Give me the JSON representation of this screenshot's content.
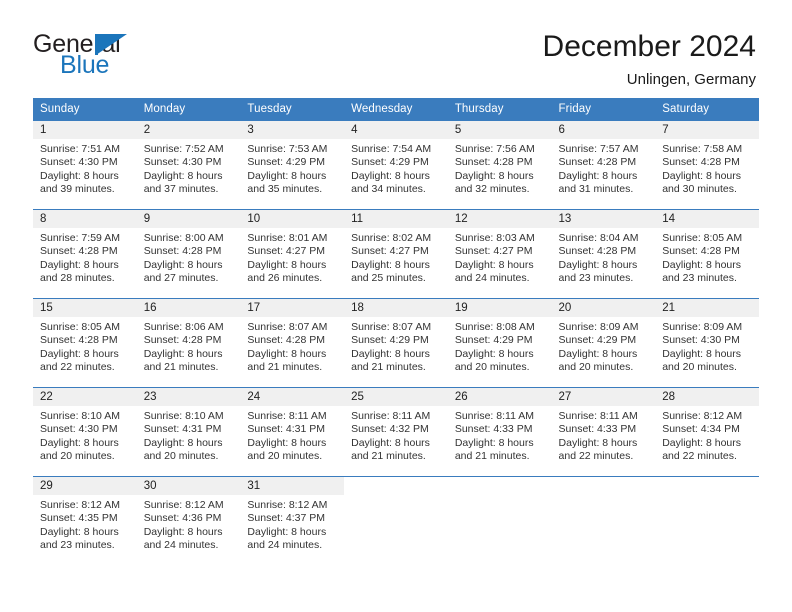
{
  "logo": {
    "word_one": "General",
    "word_two": "Blue",
    "flag_icon": "triangle-flag-icon",
    "brand_color": "#1b75bb"
  },
  "header": {
    "title": "December 2024",
    "subtitle": "Unlingen, Germany"
  },
  "theme": {
    "header_blue": "#3a7cbe",
    "daynum_band": "#f0f0f0",
    "text": "#333333"
  },
  "calendar": {
    "weekday_headers": [
      "Sunday",
      "Monday",
      "Tuesday",
      "Wednesday",
      "Thursday",
      "Friday",
      "Saturday"
    ],
    "weeks": [
      [
        {
          "day": "1",
          "sunrise": "Sunrise: 7:51 AM",
          "sunset": "Sunset: 4:30 PM",
          "daylight_line1": "Daylight: 8 hours",
          "daylight_line2": "and 39 minutes."
        },
        {
          "day": "2",
          "sunrise": "Sunrise: 7:52 AM",
          "sunset": "Sunset: 4:30 PM",
          "daylight_line1": "Daylight: 8 hours",
          "daylight_line2": "and 37 minutes."
        },
        {
          "day": "3",
          "sunrise": "Sunrise: 7:53 AM",
          "sunset": "Sunset: 4:29 PM",
          "daylight_line1": "Daylight: 8 hours",
          "daylight_line2": "and 35 minutes."
        },
        {
          "day": "4",
          "sunrise": "Sunrise: 7:54 AM",
          "sunset": "Sunset: 4:29 PM",
          "daylight_line1": "Daylight: 8 hours",
          "daylight_line2": "and 34 minutes."
        },
        {
          "day": "5",
          "sunrise": "Sunrise: 7:56 AM",
          "sunset": "Sunset: 4:28 PM",
          "daylight_line1": "Daylight: 8 hours",
          "daylight_line2": "and 32 minutes."
        },
        {
          "day": "6",
          "sunrise": "Sunrise: 7:57 AM",
          "sunset": "Sunset: 4:28 PM",
          "daylight_line1": "Daylight: 8 hours",
          "daylight_line2": "and 31 minutes."
        },
        {
          "day": "7",
          "sunrise": "Sunrise: 7:58 AM",
          "sunset": "Sunset: 4:28 PM",
          "daylight_line1": "Daylight: 8 hours",
          "daylight_line2": "and 30 minutes."
        }
      ],
      [
        {
          "day": "8",
          "sunrise": "Sunrise: 7:59 AM",
          "sunset": "Sunset: 4:28 PM",
          "daylight_line1": "Daylight: 8 hours",
          "daylight_line2": "and 28 minutes."
        },
        {
          "day": "9",
          "sunrise": "Sunrise: 8:00 AM",
          "sunset": "Sunset: 4:28 PM",
          "daylight_line1": "Daylight: 8 hours",
          "daylight_line2": "and 27 minutes."
        },
        {
          "day": "10",
          "sunrise": "Sunrise: 8:01 AM",
          "sunset": "Sunset: 4:27 PM",
          "daylight_line1": "Daylight: 8 hours",
          "daylight_line2": "and 26 minutes."
        },
        {
          "day": "11",
          "sunrise": "Sunrise: 8:02 AM",
          "sunset": "Sunset: 4:27 PM",
          "daylight_line1": "Daylight: 8 hours",
          "daylight_line2": "and 25 minutes."
        },
        {
          "day": "12",
          "sunrise": "Sunrise: 8:03 AM",
          "sunset": "Sunset: 4:27 PM",
          "daylight_line1": "Daylight: 8 hours",
          "daylight_line2": "and 24 minutes."
        },
        {
          "day": "13",
          "sunrise": "Sunrise: 8:04 AM",
          "sunset": "Sunset: 4:28 PM",
          "daylight_line1": "Daylight: 8 hours",
          "daylight_line2": "and 23 minutes."
        },
        {
          "day": "14",
          "sunrise": "Sunrise: 8:05 AM",
          "sunset": "Sunset: 4:28 PM",
          "daylight_line1": "Daylight: 8 hours",
          "daylight_line2": "and 23 minutes."
        }
      ],
      [
        {
          "day": "15",
          "sunrise": "Sunrise: 8:05 AM",
          "sunset": "Sunset: 4:28 PM",
          "daylight_line1": "Daylight: 8 hours",
          "daylight_line2": "and 22 minutes."
        },
        {
          "day": "16",
          "sunrise": "Sunrise: 8:06 AM",
          "sunset": "Sunset: 4:28 PM",
          "daylight_line1": "Daylight: 8 hours",
          "daylight_line2": "and 21 minutes."
        },
        {
          "day": "17",
          "sunrise": "Sunrise: 8:07 AM",
          "sunset": "Sunset: 4:28 PM",
          "daylight_line1": "Daylight: 8 hours",
          "daylight_line2": "and 21 minutes."
        },
        {
          "day": "18",
          "sunrise": "Sunrise: 8:07 AM",
          "sunset": "Sunset: 4:29 PM",
          "daylight_line1": "Daylight: 8 hours",
          "daylight_line2": "and 21 minutes."
        },
        {
          "day": "19",
          "sunrise": "Sunrise: 8:08 AM",
          "sunset": "Sunset: 4:29 PM",
          "daylight_line1": "Daylight: 8 hours",
          "daylight_line2": "and 20 minutes."
        },
        {
          "day": "20",
          "sunrise": "Sunrise: 8:09 AM",
          "sunset": "Sunset: 4:29 PM",
          "daylight_line1": "Daylight: 8 hours",
          "daylight_line2": "and 20 minutes."
        },
        {
          "day": "21",
          "sunrise": "Sunrise: 8:09 AM",
          "sunset": "Sunset: 4:30 PM",
          "daylight_line1": "Daylight: 8 hours",
          "daylight_line2": "and 20 minutes."
        }
      ],
      [
        {
          "day": "22",
          "sunrise": "Sunrise: 8:10 AM",
          "sunset": "Sunset: 4:30 PM",
          "daylight_line1": "Daylight: 8 hours",
          "daylight_line2": "and 20 minutes."
        },
        {
          "day": "23",
          "sunrise": "Sunrise: 8:10 AM",
          "sunset": "Sunset: 4:31 PM",
          "daylight_line1": "Daylight: 8 hours",
          "daylight_line2": "and 20 minutes."
        },
        {
          "day": "24",
          "sunrise": "Sunrise: 8:11 AM",
          "sunset": "Sunset: 4:31 PM",
          "daylight_line1": "Daylight: 8 hours",
          "daylight_line2": "and 20 minutes."
        },
        {
          "day": "25",
          "sunrise": "Sunrise: 8:11 AM",
          "sunset": "Sunset: 4:32 PM",
          "daylight_line1": "Daylight: 8 hours",
          "daylight_line2": "and 21 minutes."
        },
        {
          "day": "26",
          "sunrise": "Sunrise: 8:11 AM",
          "sunset": "Sunset: 4:33 PM",
          "daylight_line1": "Daylight: 8 hours",
          "daylight_line2": "and 21 minutes."
        },
        {
          "day": "27",
          "sunrise": "Sunrise: 8:11 AM",
          "sunset": "Sunset: 4:33 PM",
          "daylight_line1": "Daylight: 8 hours",
          "daylight_line2": "and 22 minutes."
        },
        {
          "day": "28",
          "sunrise": "Sunrise: 8:12 AM",
          "sunset": "Sunset: 4:34 PM",
          "daylight_line1": "Daylight: 8 hours",
          "daylight_line2": "and 22 minutes."
        }
      ],
      [
        {
          "day": "29",
          "sunrise": "Sunrise: 8:12 AM",
          "sunset": "Sunset: 4:35 PM",
          "daylight_line1": "Daylight: 8 hours",
          "daylight_line2": "and 23 minutes."
        },
        {
          "day": "30",
          "sunrise": "Sunrise: 8:12 AM",
          "sunset": "Sunset: 4:36 PM",
          "daylight_line1": "Daylight: 8 hours",
          "daylight_line2": "and 24 minutes."
        },
        {
          "day": "31",
          "sunrise": "Sunrise: 8:12 AM",
          "sunset": "Sunset: 4:37 PM",
          "daylight_line1": "Daylight: 8 hours",
          "daylight_line2": "and 24 minutes."
        },
        {
          "day": "",
          "sunrise": "",
          "sunset": "",
          "daylight_line1": "",
          "daylight_line2": ""
        },
        {
          "day": "",
          "sunrise": "",
          "sunset": "",
          "daylight_line1": "",
          "daylight_line2": ""
        },
        {
          "day": "",
          "sunrise": "",
          "sunset": "",
          "daylight_line1": "",
          "daylight_line2": ""
        },
        {
          "day": "",
          "sunrise": "",
          "sunset": "",
          "daylight_line1": "",
          "daylight_line2": ""
        }
      ]
    ]
  }
}
